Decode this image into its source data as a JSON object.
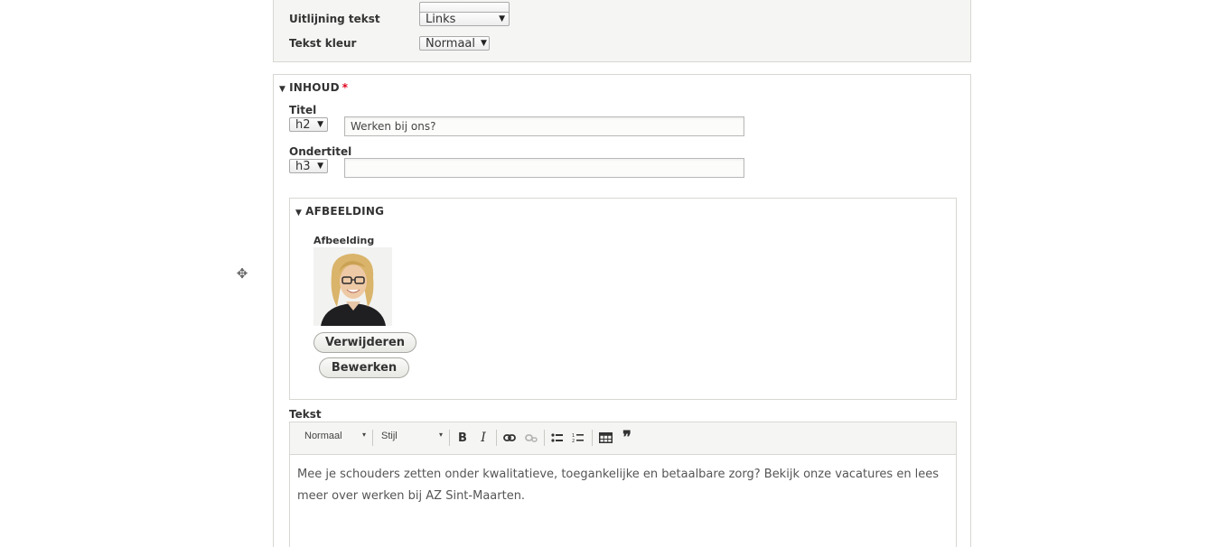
{
  "settings": {
    "alignment_label": "Uitlijning tekst",
    "alignment_value": "Links",
    "color_label": "Tekst kleur",
    "color_value": "Normaal"
  },
  "inhoud": {
    "legend": "INHOUD",
    "required_mark": "*",
    "title_label": "Titel",
    "title_heading": "h2",
    "title_value": "Werken bij ons?",
    "subtitle_label": "Ondertitel",
    "subtitle_heading": "h3",
    "subtitle_value": ""
  },
  "afbeelding": {
    "legend": "AFBEELDING",
    "field_label": "Afbeelding",
    "remove_button": "Verwijderen",
    "edit_button": "Bewerken"
  },
  "tekst": {
    "label": "Tekst",
    "format_combo": "Normaal",
    "style_combo": "Stijl",
    "body": "Mee je schouders zetten onder kwalitatieve, toegankelijke en betaalbare zorg? Bekijk onze vacatures en lees meer over werken bij AZ Sint-Maarten."
  },
  "icons": {
    "drag": "drag-handle-icon",
    "bold": "bold-icon",
    "italic": "italic-icon",
    "link": "link-icon",
    "unlink": "unlink-icon",
    "bulleted_list": "bulleted-list-icon",
    "numbered_list": "numbered-list-icon",
    "table": "table-icon",
    "blockquote": "blockquote-icon"
  },
  "colors": {
    "required": "#e0001b",
    "panel_bg": "#f5f5f3",
    "border": "#d7d7d3"
  }
}
